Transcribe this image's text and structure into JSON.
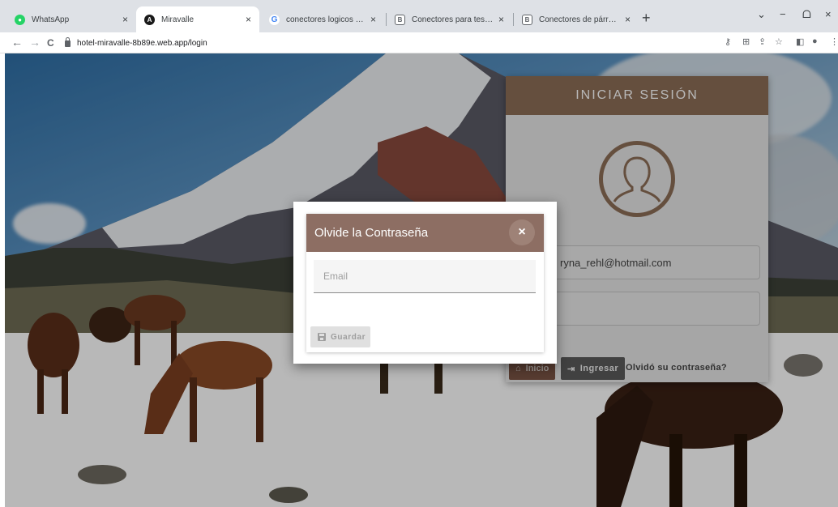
{
  "browser": {
    "tabs": [
      {
        "title": "WhatsApp",
        "favicon_color": "#25d366",
        "active": false
      },
      {
        "title": "Miravalle",
        "favicon_color": "#1a1a1a",
        "active": true
      },
      {
        "title": "conectores logicos para tesis - B",
        "favicon_color": "#4285f4",
        "active": false
      },
      {
        "title": "Conectores para tesis: la lista def",
        "favicon_color": "#5f6368",
        "active": false
      },
      {
        "title": "Conectores de párrafos: listado p",
        "favicon_color": "#5f6368",
        "active": false
      }
    ],
    "close_glyph": "×",
    "new_tab_glyph": "+",
    "url": "hotel-miravalle-8b89e.web.app/login",
    "back_glyph": "←",
    "forward_glyph": "→",
    "reload_glyph": "C",
    "window_controls": {
      "dropdown": "⌄",
      "minimize": "−",
      "restore": "ᗝ",
      "close": "×"
    }
  },
  "login": {
    "title": "INICIAR SESIÓN",
    "email_value": "ryna_rehl@hotmail.com",
    "home_button": "Inicio",
    "login_button": "Ingresar",
    "forgot_link": "Olvidó su contraseña?"
  },
  "modal": {
    "title": "Olvide la Contraseña",
    "close_glyph": "×",
    "email_placeholder": "Email",
    "save_button": "Guardar"
  },
  "colors": {
    "brand_brown": "#8d6e57",
    "modal_header": "#8d6e63"
  }
}
